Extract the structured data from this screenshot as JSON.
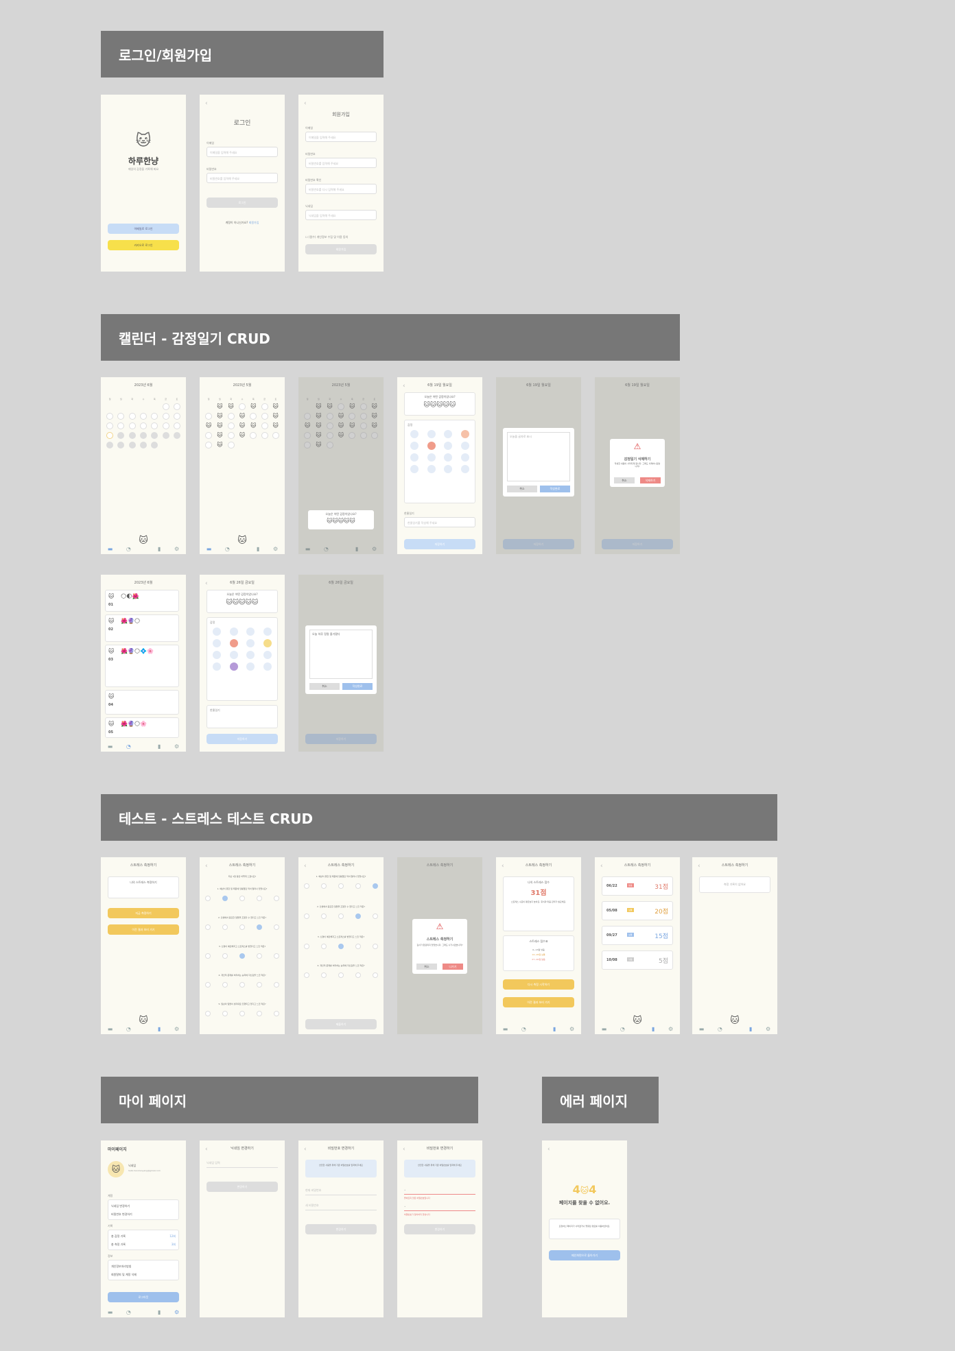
{
  "sections": {
    "login": "로그인/회원가입",
    "calendar": "캘린더 - 감정일기 CRUD",
    "test": "테스트 - 스트레스 테스트 CRUD",
    "mypage": "마이 페이지",
    "error": "에러 페이지"
  },
  "splash": {
    "app_name": "하루한냥",
    "tagline": "매일의 감정을 기록해 봐요",
    "naver_btn": "이메일로 로그인",
    "kakao_btn": "카카오로 로그인"
  },
  "login": {
    "title": "로그인",
    "email_label": "이메일",
    "email_ph": "이메일을 입력해 주세요",
    "pw_label": "비밀번호",
    "pw_ph": "비밀번호를 입력해 주세요",
    "submit": "로그인",
    "signup_prompt": "계정이 아니신가요?",
    "signup_link": "회원가입"
  },
  "signup": {
    "title": "회원가입",
    "f1": "이메일",
    "f1_ph": "이메일을 입력해 주세요",
    "f2": "비밀번호",
    "f2_ph": "비밀번호를 입력해 주세요",
    "f3": "비밀번호 확인",
    "f3_ph": "비밀번호를 다시 입력해 주세요",
    "f4": "닉네임",
    "f4_ph": "닉네임을 입력해 주세요",
    "agree": "(필수) 개인정보 수집 및 이용 동의",
    "submit": "회원가입"
  },
  "calendar": {
    "month1": "2023년 6월",
    "month2": "2023년 5월",
    "month3": "2023년 5월",
    "weekdays": [
      "일",
      "월",
      "화",
      "수",
      "목",
      "금",
      "토"
    ],
    "popup_q": "오늘은 어떤 감정이었나요?"
  },
  "diary": {
    "date1": "6월 19일 월요일",
    "date2": "6월 19일 월요일",
    "date3": "6월 19일 월요일",
    "date4": "6월 26일 금요일",
    "date5": "6월 26일 금요일",
    "mood_q": "오늘은 어떤 감정이었나요?",
    "emotion_label": "감정",
    "diary_label": "한줄일기",
    "diary_ph": "한줄일기를 작성해 주세요",
    "save": "저장하기",
    "write_ph": "오늘을 글자로 표시",
    "cancel": "취소",
    "confirm": "작성완료",
    "delete_title": "감정일기 삭제하기",
    "delete_msg": "작성한 내용이 사라지게 됩니다. 그래도 삭제하시겠습니까?",
    "delete_btn": "삭제하기",
    "edit_text": "오늘 하루 정말 즐거웠다"
  },
  "list": {
    "month": "2023년 6월",
    "days": [
      "01",
      "02",
      "03",
      "04",
      "05"
    ],
    "wk": [
      "목요일",
      "금요일",
      "토요일",
      "일요일",
      "월요일"
    ]
  },
  "test": {
    "title": "스트레스 측정하기",
    "intro": "나의 스트레스 측정하기",
    "start": "지금 측정하기",
    "history": "이전 결과 보러 가기",
    "q_intro": "지난 1달 동안 어떻게 느꼈나요?",
    "questions": [
      "1. 예상치 못한 일 때문에 당황했던 적이 얼마나 있었나요?",
      "2. 인생에서 중요한 일들을 조절할 수 없다고 느낀 적은?",
      "3. 신경이 예민해지고 스트레스를 받았다고 느낀 적은?",
      "4. 개인적 문제를 처리하는 능력에 자신감을 느낀 적은?",
      "5. 일상의 일들이 생각대로 진행되고 있다고 느낀 적은?",
      "6. 자신이 해야 할 일을 모두 감당할 수 없다고 느낀 적은?"
    ],
    "opts": [
      "전혀 없음",
      "거의 없음",
      "가끔",
      "자주",
      "매우 자주"
    ],
    "submit": "제출하기",
    "dlg_title": "스트레스 측정하기",
    "dlg_msg": "검사가 완료되지 않았습니다. 그래도 나가시겠습니까?",
    "dlg_cancel": "취소",
    "dlg_ok": "나가기",
    "result_title": "나의 스트레스 점수",
    "score": "31점",
    "result_desc": "스트레스 수준이 평균보다 높아요. 휴식과 마음 관리가 필요해요.",
    "guide_title": "스트레스 점수표",
    "guide": [
      "0~13점 낮음",
      "14~26점 보통",
      "27~40점 높음"
    ],
    "retest": "다시 측정 시작하기",
    "view_all": "이전 결과 보러 가기",
    "records": [
      {
        "date": "06/22",
        "score": "31점",
        "level": "높음"
      },
      {
        "date": "05/08",
        "score": "20점",
        "level": "보통"
      },
      {
        "date": "09/27",
        "score": "15점",
        "level": "보통"
      },
      {
        "date": "10/08",
        "score": "5점",
        "level": "낮음"
      }
    ],
    "empty": "측정 기록이 없어요"
  },
  "mypage": {
    "title": "마이페이지",
    "nickname": "닉네임",
    "email": "hello.haruhanyang@gmail.com",
    "s1": "계정",
    "s1_items": [
      "닉네임 변경하기",
      "비밀번호 변경하기"
    ],
    "s2": "기록",
    "s2_items": [
      "총 감정 기록",
      "총 측정 기록"
    ],
    "s2_vals": [
      "12회",
      "3회"
    ],
    "s3": "정보",
    "s3_items": [
      "개인정보처리방침",
      "회원탈퇴 및 계정 삭제"
    ],
    "logout": "로그아웃",
    "nick_title": "닉네임 변경하기",
    "nick_ph": "닉네임 입력",
    "save": "변경하기",
    "pw_title": "비밀번호 변경하기",
    "pw_notice": "안전한 사용을 위해 기존 비밀번호를 입력해 주세요",
    "pw_ph1": "현재 비밀번호",
    "pw_ph2": "새 비밀번호",
    "pw_err1": "올바르지 않은 비밀번호입니다",
    "pw_err2": "비밀번호가 일치하지 않습니다"
  },
  "error": {
    "code_left": "4",
    "code_right": "4",
    "message": "페이지를 찾을 수 없어요.",
    "desc": "요청하신 페이지가 사라졌거나 잘못된 경로를 이용하셨어요.",
    "home": "메인화면으로 돌아가기"
  }
}
